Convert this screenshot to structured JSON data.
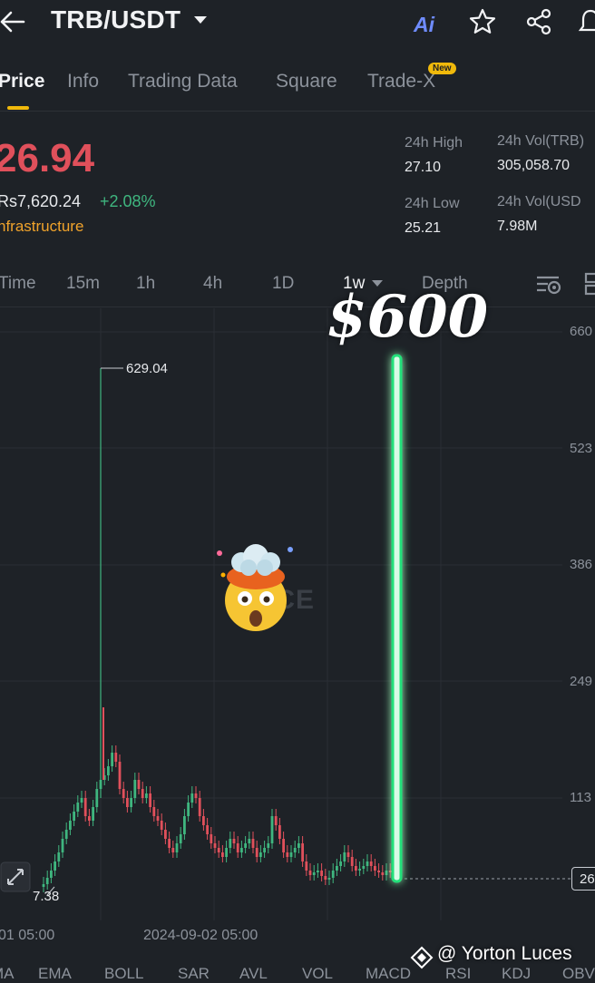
{
  "header": {
    "pair": "TRB/USDT",
    "ai_label": "Ai"
  },
  "tabs": [
    {
      "label": "Price"
    },
    {
      "label": "Info"
    },
    {
      "label": "Trading Data"
    },
    {
      "label": "Square"
    },
    {
      "label": "Trade-X"
    }
  ],
  "new_badge": "New",
  "price": {
    "last": "26.94",
    "local": "Rs7,620.24",
    "change": "+2.08%",
    "category": "nfrastructure"
  },
  "stats": {
    "high_label": "24h High",
    "high_value": "27.10",
    "low_label": "24h Low",
    "low_value": "25.21",
    "vol_trb_label": "24h Vol(TRB)",
    "vol_trb_value": "305,058.70",
    "vol_usdt_label": "24h Vol(USD",
    "vol_usdt_value": "7.98M"
  },
  "timeframes": [
    "Time",
    "15m",
    "1h",
    "4h",
    "1D",
    "1w",
    "Depth"
  ],
  "chart": {
    "watermark": "ANCE",
    "overlay_text": "$600",
    "max_label": "629.04",
    "min_label": "7.38",
    "y_ticks": [
      "660",
      "523",
      "386",
      "249",
      "113"
    ],
    "current_tag": "26",
    "x_labels": [
      "01 05:00",
      "2024-09-02 05:00"
    ]
  },
  "indicators": [
    "MA",
    "EMA",
    "BOLL",
    "SAR",
    "AVL",
    "VOL",
    "MACD",
    "RSI",
    "KDJ",
    "OBV"
  ],
  "credit": "@ Yorton Luces",
  "colors": {
    "bg": "#1e2227",
    "up": "#3fb67f",
    "down": "#e0505b",
    "accent": "#f0b90b"
  },
  "chart_data": {
    "type": "candlestick",
    "title": "",
    "ylim": [
      0,
      660
    ],
    "y_ticks": [
      660,
      523,
      386,
      249,
      113
    ],
    "max_point": 629.04,
    "min_point": 7.38,
    "current": 26.94,
    "overlay_target": 600
  }
}
